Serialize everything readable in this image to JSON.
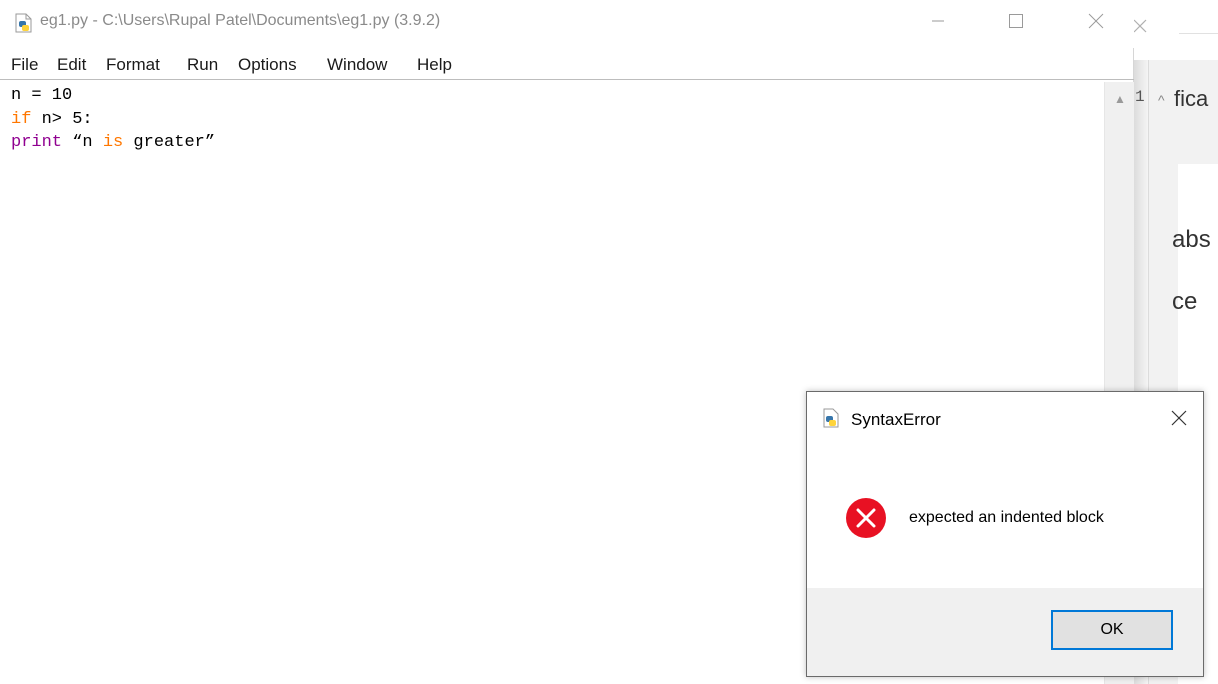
{
  "idle": {
    "title": "eg1.py - C:\\Users\\Rupal Patel\\Documents\\eg1.py (3.9.2)",
    "menu": [
      "File",
      "Edit",
      "Format",
      "Run",
      "Options",
      "Window",
      "Help"
    ],
    "code": {
      "line1": "n = 10",
      "line2_kw": "if",
      "line2_rest": " n> 5:",
      "line3_builtin": "print",
      "line3_a": " “n ",
      "line3_kw": "is",
      "line3_b": " greater”"
    }
  },
  "background_window": {
    "text1": "fica",
    "text2": "abs",
    "text3": "ce",
    "caret1": "^",
    "caret_letter": "1",
    "caret2": "^"
  },
  "dialog": {
    "title": "SyntaxError",
    "message": "expected an indented block",
    "ok_label": "OK"
  },
  "colors": {
    "keyword": "#ff7700",
    "builtin": "#900090",
    "error_red": "#e81123",
    "focus_blue": "#0078d7"
  },
  "icons": {
    "app": "python-icon",
    "error": "error-x-icon"
  }
}
